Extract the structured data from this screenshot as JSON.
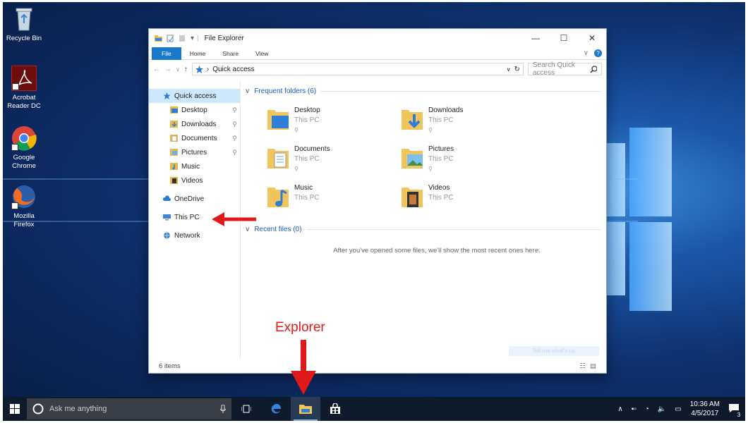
{
  "desktop": {
    "icons": [
      {
        "label": "Recycle Bin"
      },
      {
        "label": "Acrobat Reader DC"
      },
      {
        "label": "Google Chrome"
      },
      {
        "label": "Mozilla Firefox"
      }
    ]
  },
  "window": {
    "title": "File Explorer",
    "controls": {
      "minimize": "—",
      "maximize": "☐",
      "close": "✕"
    },
    "ribbon_tabs": [
      "File",
      "Home",
      "Share",
      "View"
    ],
    "help": "?",
    "address": {
      "back": "←",
      "forward": "→",
      "recent": "∨",
      "up": "↑",
      "path": "Quick access",
      "separator": "›",
      "dropdown": "∨",
      "refresh": "↻"
    },
    "search": {
      "placeholder": "Search Quick access",
      "icon": "⚲"
    }
  },
  "nav": {
    "items": [
      {
        "label": "Quick access",
        "icon": "star-icon",
        "selected": true
      },
      {
        "label": "Desktop",
        "icon": "desktop-folder-icon",
        "pinned": true
      },
      {
        "label": "Downloads",
        "icon": "downloads-folder-icon",
        "pinned": true
      },
      {
        "label": "Documents",
        "icon": "documents-folder-icon",
        "pinned": true
      },
      {
        "label": "Pictures",
        "icon": "pictures-folder-icon",
        "pinned": true
      },
      {
        "label": "Music",
        "icon": "music-folder-icon"
      },
      {
        "label": "Videos",
        "icon": "videos-folder-icon"
      },
      {
        "label": "OneDrive",
        "icon": "cloud-icon"
      },
      {
        "label": "This PC",
        "icon": "computer-icon"
      },
      {
        "label": "Network",
        "icon": "network-icon"
      }
    ],
    "pin_glyph": "⚲"
  },
  "main": {
    "frequent_header": "Frequent folders (6)",
    "folders": [
      {
        "name": "Desktop",
        "location": "This PC",
        "pinned": true
      },
      {
        "name": "Downloads",
        "location": "This PC",
        "pinned": true
      },
      {
        "name": "Documents",
        "location": "This PC",
        "pinned": true
      },
      {
        "name": "Pictures",
        "location": "This PC",
        "pinned": true
      },
      {
        "name": "Music",
        "location": "This PC",
        "pinned": false
      },
      {
        "name": "Videos",
        "location": "This PC",
        "pinned": false
      }
    ],
    "recent_header": "Recent files (0)",
    "recent_empty": "After you've opened some files, we'll show the most recent ones here.",
    "ghost_button": "Tell me what's up"
  },
  "status": {
    "items": "6 items"
  },
  "taskbar": {
    "search_placeholder": "Ask me anything",
    "time": "10:36 AM",
    "date": "4/5/2017",
    "notifications": "3"
  },
  "annotation": {
    "label": "Explorer",
    "color": "#e0191a"
  },
  "colors": {
    "accent": "#1979ca",
    "selection": "#cce8ff",
    "section_header": "#1e5bb8"
  }
}
